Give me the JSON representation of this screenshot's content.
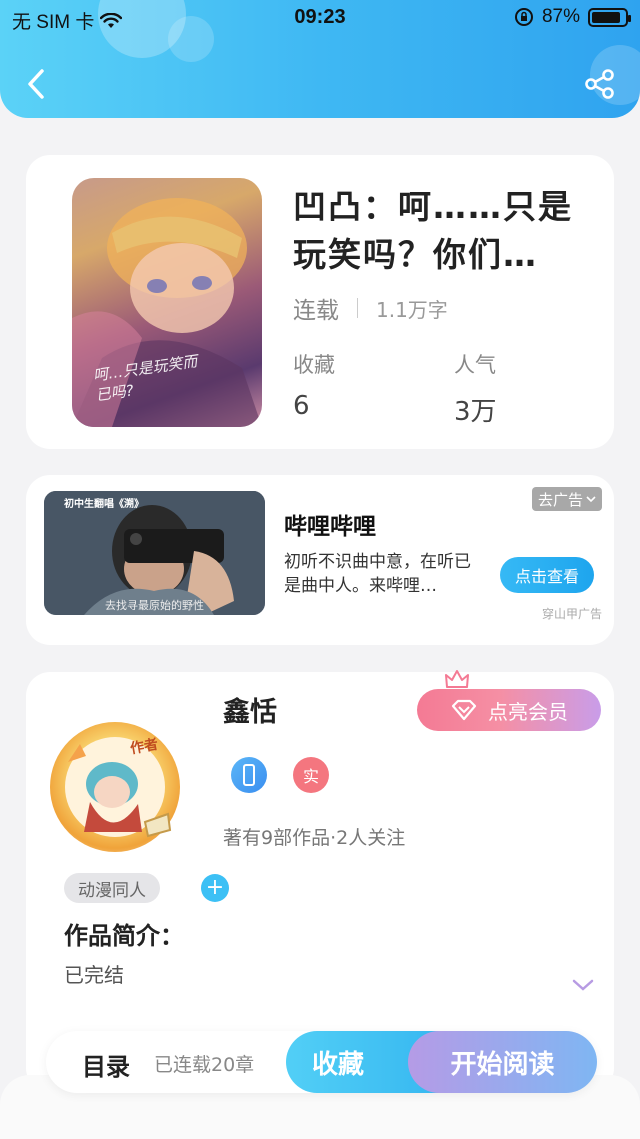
{
  "status_bar": {
    "carrier": "无 SIM 卡",
    "time": "09:23",
    "battery": "87%",
    "battery_level": 0.87
  },
  "header": {
    "back_icon": "chevron-left-icon",
    "share_icon": "share-icon"
  },
  "book": {
    "title": "凹凸：呵……只是玩笑吗？你们…",
    "status": "连载",
    "word_count": "1.1万字",
    "favorites_label": "收藏",
    "favorites_value": "6",
    "popularity_label": "人气",
    "popularity_value": "3万",
    "cover_caption": "呵…只是玩笑而已吗?"
  },
  "ad": {
    "thumb_caption_top": "初中生翻唱《溯》",
    "thumb_caption_bottom": "去找寻最原始的野性",
    "title": "哔哩哔哩",
    "description": "初听不识曲中意，在听已是曲中人。来哔哩…",
    "button": "点击查看",
    "close_label": "去广告",
    "source": "穿山甲广告"
  },
  "author": {
    "name": "鑫恬",
    "vip_button": "点亮会员",
    "avatar_badge": "作者",
    "badge_real": "实",
    "stats": "著有9部作品·2人关注",
    "tag": "动漫同人",
    "tag_add": "+",
    "intro_title": "作品简介：",
    "intro_text": "已完结"
  },
  "bottom_bar": {
    "toc_label": "目录",
    "chapter_count": "已连载20章",
    "favorite_button": "收藏",
    "read_button": "开始阅读"
  },
  "colors": {
    "header_start": "#5bd2f7",
    "header_end": "#2fa3ef",
    "accent_blue": "#2fb1ef",
    "vip_pink": "#f47a94",
    "read_purple": "#b59be6"
  }
}
